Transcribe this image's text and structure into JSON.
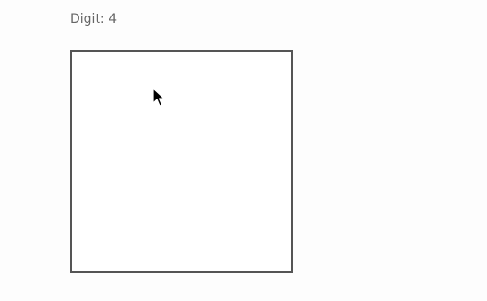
{
  "header": {
    "digit_label": "Digit: 4"
  },
  "canvas": {
    "border_color": "#555555",
    "background": "#ffffff"
  },
  "cursor": {
    "icon": "mouse-pointer-icon"
  }
}
